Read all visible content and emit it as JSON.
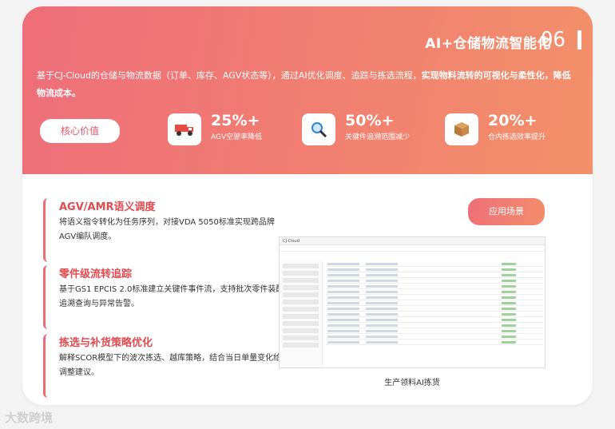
{
  "header": {
    "title": "AI+仓储物流智能化",
    "number": "06"
  },
  "intro": {
    "text": "基于CJ-Cloud的仓储与物流数据（订单、库存、AGV状态等），通过AI优化调度、追踪与拣选流程，",
    "bold": "实现物料流转的可视化与柔性化，降低物流成本。"
  },
  "core_label": "核心价值",
  "stats": [
    {
      "icon": "truck-icon",
      "value": "25%+",
      "label": "AGV空驶率降低"
    },
    {
      "icon": "magnifier-icon",
      "value": "50%+",
      "label": "关键件追溯范围减少"
    },
    {
      "icon": "box-icon",
      "value": "20%+",
      "label": "仓内拣选效率提升"
    }
  ],
  "features": [
    {
      "title": "AGV/AMR语义调度",
      "desc": "将语义指令转化为任务序列，对接VDA 5050标准实现跨品牌AGV编队调度。"
    },
    {
      "title": "零件级流转追踪",
      "desc": "基于GS1 EPCIS 2.0标准建立关键件事件流，支持批次零件装配追溯查询与异常告警。"
    },
    {
      "title": "拣选与补货策略优化",
      "desc": "解释SCOR模型下的波次拣选、越库策略，结合当日单量变化给出调整建议。"
    }
  ],
  "scene_label": "应用场景",
  "screenshot": {
    "title": "CJ-Cloud"
  },
  "caption": "生产领料AI拣货",
  "watermark": "大数跨境"
}
